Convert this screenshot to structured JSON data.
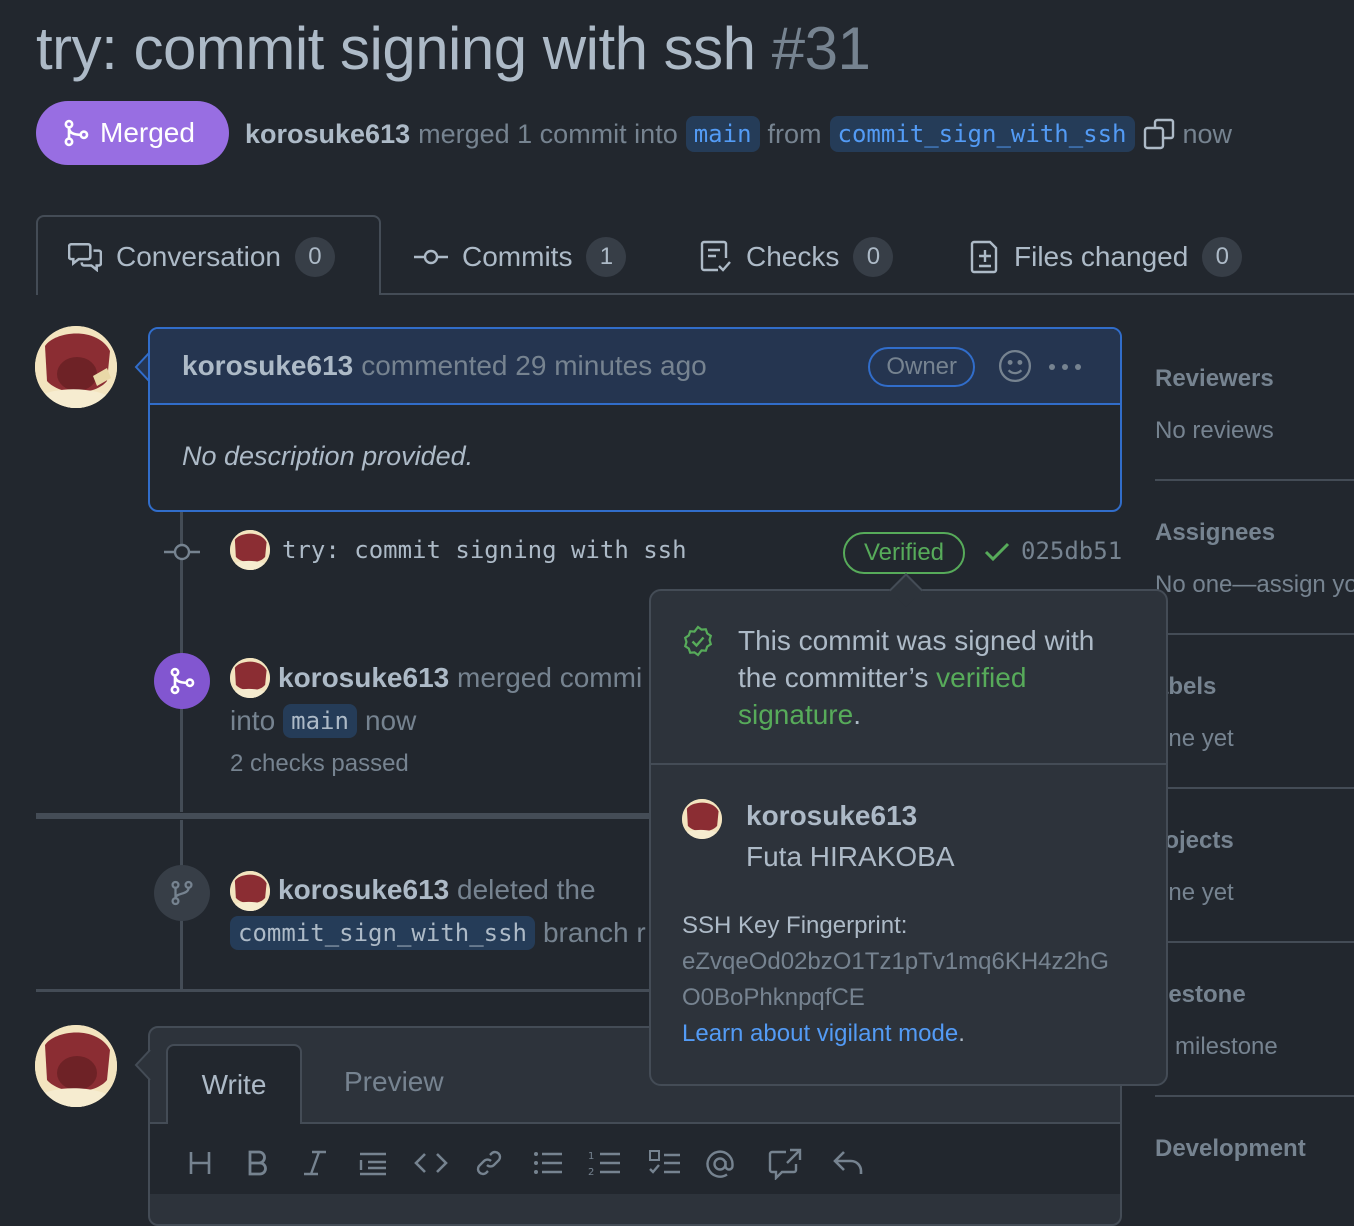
{
  "pr": {
    "title": "try: commit signing with ssh",
    "number": "#31",
    "state": "Merged",
    "merger": "korosuke613",
    "merged_text": "merged 1 commit into",
    "base_branch": "main",
    "from_text": "from",
    "head_branch": "commit_sign_with_ssh",
    "time": "now"
  },
  "tabs": [
    {
      "label": "Conversation",
      "count": "0",
      "icon": "comment-discussion-icon"
    },
    {
      "label": "Commits",
      "count": "1",
      "icon": "git-commit-icon"
    },
    {
      "label": "Checks",
      "count": "0",
      "icon": "checklist-icon"
    },
    {
      "label": "Files changed",
      "count": "0",
      "icon": "file-diff-icon"
    }
  ],
  "comment": {
    "author": "korosuke613",
    "action": "commented 29 minutes ago",
    "badge": "Owner",
    "body": "No description provided."
  },
  "commit": {
    "message": "try: commit signing with ssh",
    "verified": "Verified",
    "sha": "025db51"
  },
  "merge_event": {
    "author": "korosuke613",
    "text1": "merged commi",
    "text2": "into",
    "branch": "main",
    "time": "now",
    "checks": "2 checks passed"
  },
  "delete_event": {
    "author": "korosuke613",
    "text1": "deleted the",
    "branch": "commit_sign_with_ssh",
    "text2": "branch r"
  },
  "sidebar": {
    "reviewers": {
      "head": "Reviewers",
      "value": "No reviews"
    },
    "assignees": {
      "head": "Assignees",
      "value": "No one—assign yo"
    },
    "labels": {
      "head": "abels",
      "value": "one yet"
    },
    "projects": {
      "head": "rojects",
      "value": "one yet"
    },
    "milestone": {
      "head": "ilestone",
      "value": "o milestone"
    },
    "development": {
      "head": "Development"
    }
  },
  "popover": {
    "title_prefix": "This commit was signed with the committer’s ",
    "title_green": "verified signature",
    "title_suffix": ".",
    "username": "korosuke613",
    "fullname": "Futa HIRAKOBA",
    "key_label": "SSH Key Fingerprint:",
    "key_line1": "eZvqeOd02bzO1Tz1pTv1mq6KH4z2hG",
    "key_line2": "O0BoPhknpqfCE",
    "link": "Learn about vigilant mode",
    "link_suffix": "."
  },
  "editor": {
    "write_tab": "Write",
    "preview_tab": "Preview",
    "toolbar": [
      "heading-icon",
      "bold-icon",
      "italic-icon",
      "quote-icon",
      "code-icon",
      "link-icon",
      "bulleted-list-icon",
      "numbered-list-icon",
      "task-list-icon",
      "mention-icon",
      "cross-reference-icon",
      "reply-icon"
    ]
  },
  "colors": {
    "background": "#22272e",
    "accent_blue": "#316dca",
    "merged_purple": "#986ee2",
    "verified_green": "#57ab5a",
    "link_blue": "#539bf5"
  }
}
